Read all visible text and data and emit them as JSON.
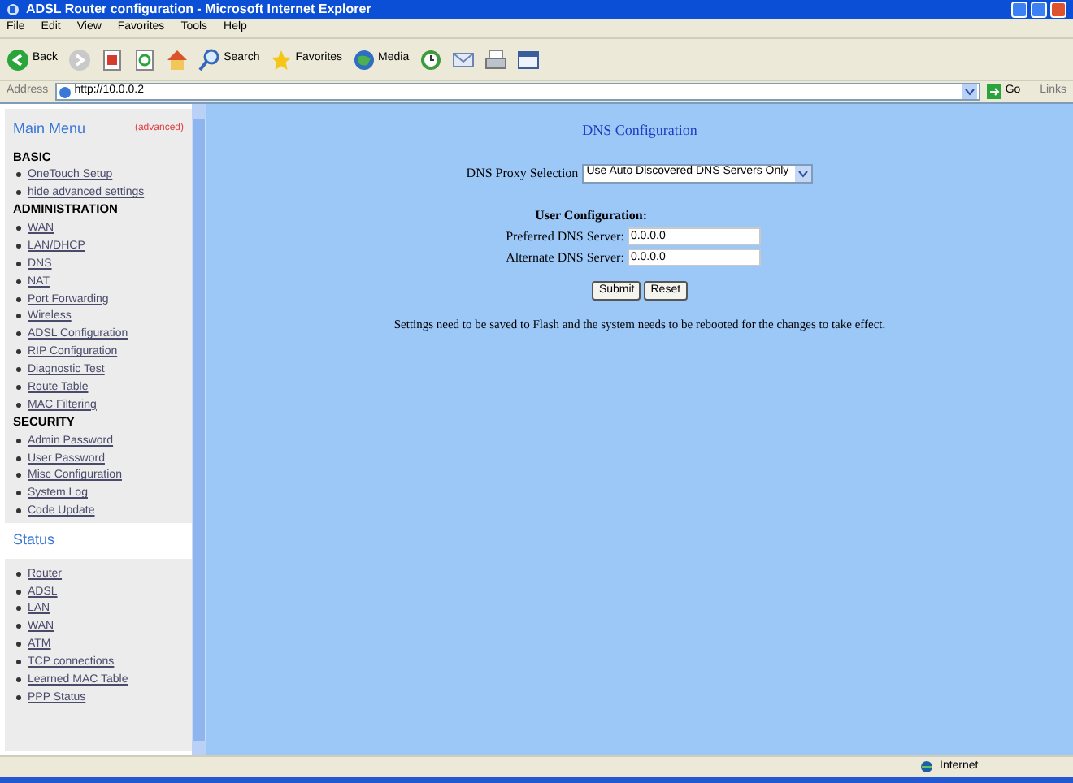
{
  "window": {
    "title": "ADSL Router configuration - Microsoft Internet Explorer"
  },
  "menu_bar": [
    "File",
    "Edit",
    "View",
    "Favorites",
    "Tools",
    "Help"
  ],
  "toolbar": [
    {
      "kind": "back",
      "label": "Back"
    },
    {
      "kind": "forward"
    },
    {
      "kind": "stop"
    },
    {
      "kind": "refresh"
    },
    {
      "kind": "home"
    },
    {
      "kind": "search",
      "label": "Search"
    },
    {
      "kind": "favorites",
      "label": "Favorites"
    },
    {
      "kind": "media",
      "label": "Media"
    },
    {
      "kind": "history"
    },
    {
      "kind": "mail"
    },
    {
      "kind": "print"
    },
    {
      "kind": "edit"
    }
  ],
  "address_bar": {
    "label": "Address",
    "value": "http://10.0.0.2",
    "go": "Go",
    "links": "Links"
  },
  "sidebar": {
    "title": "Main Menu",
    "mode": "(advanced)",
    "sections": [
      {
        "heading": "BASIC",
        "items": [
          "OneTouch Setup",
          "hide advanced settings"
        ]
      },
      {
        "heading": "ADMINISTRATION",
        "items": [
          "WAN",
          "LAN/DHCP",
          "DNS",
          "NAT",
          "Port Forwarding",
          "Wireless",
          "ADSL Configuration",
          "RIP Configuration",
          "Diagnostic Test",
          "Route Table",
          "MAC Filtering"
        ]
      },
      {
        "heading": "SECURITY",
        "items": [
          "Admin Password",
          "User Password",
          "Misc Configuration",
          "System Log",
          "Code Update"
        ]
      }
    ],
    "status_title": "Status",
    "status_items": [
      "Router",
      "ADSL",
      "LAN",
      "WAN",
      "ATM",
      "TCP connections",
      "Learned MAC Table",
      "PPP Status"
    ]
  },
  "content": {
    "title": "DNS Configuration",
    "proxy_label": "DNS Proxy Selection",
    "proxy_value": "Use Auto Discovered DNS Servers Only",
    "user_config_heading": "User Configuration:",
    "fields": [
      {
        "label": "Preferred DNS Server:",
        "value": "0.0.0.0"
      },
      {
        "label": "Alternate DNS Server:",
        "value": "0.0.0.0"
      }
    ],
    "buttons": [
      "Submit",
      "Reset"
    ],
    "note": "Settings need to be saved to Flash and the system needs to be rebooted for the changes to take effect."
  },
  "status_bar": {
    "zone": "Internet"
  }
}
